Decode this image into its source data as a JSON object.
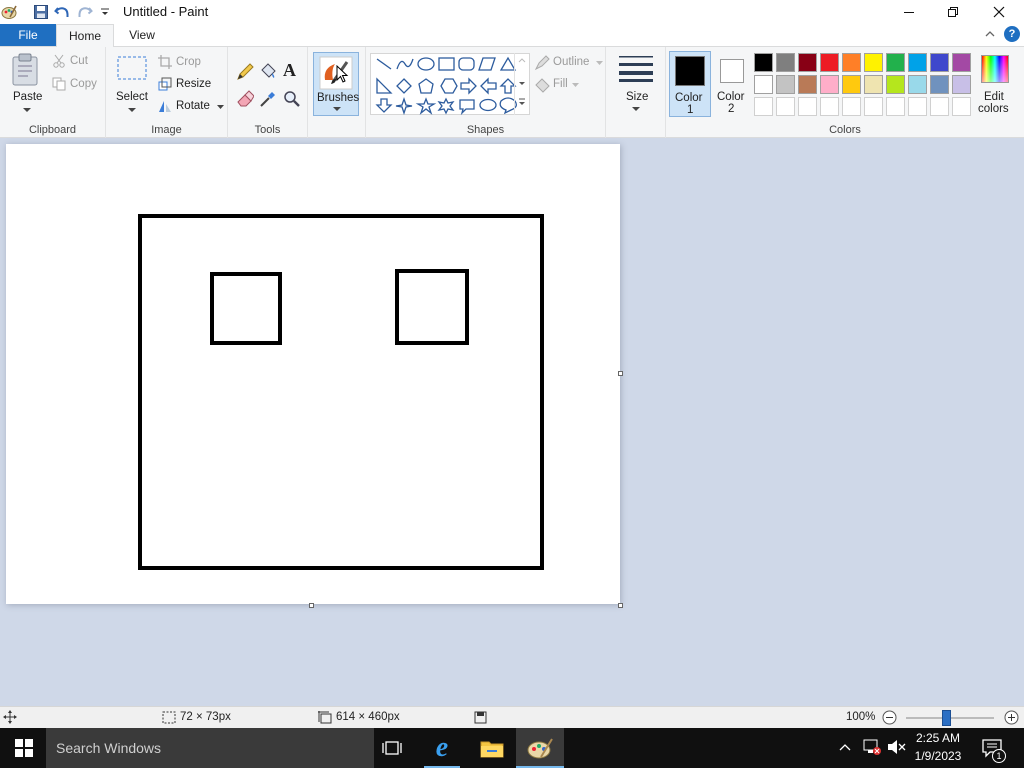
{
  "app": {
    "title": "Untitled - Paint"
  },
  "tabs": {
    "file": "File",
    "home": "Home",
    "view": "View"
  },
  "ribbon": {
    "clipboard": {
      "paste": "Paste",
      "cut": "Cut",
      "copy": "Copy",
      "group": "Clipboard"
    },
    "image": {
      "select": "Select",
      "crop": "Crop",
      "resize": "Resize",
      "rotate": "Rotate",
      "group": "Image"
    },
    "tools": {
      "group": "Tools"
    },
    "brushes": {
      "label": "Brushes"
    },
    "shapes": {
      "outline": "Outline",
      "fill": "Fill",
      "group": "Shapes"
    },
    "size": {
      "label": "Size"
    },
    "colors": {
      "color1": "Color 1",
      "color1_a": "Color",
      "color1_b": "1",
      "color2": "Color 2",
      "color2_a": "Color",
      "color2_b": "2",
      "edit": "Edit colors",
      "edit_a": "Edit",
      "edit_b": "colors",
      "group": "Colors",
      "color1_value": "#000000",
      "color2_value": "#ffffff",
      "palette_row1": [
        "#000000",
        "#7f7f7f",
        "#880015",
        "#ed1c24",
        "#ff7f27",
        "#fff200",
        "#22b14c",
        "#00a2e8",
        "#3f48cc",
        "#a349a4"
      ],
      "palette_row2": [
        "#ffffff",
        "#c3c3c3",
        "#b97a57",
        "#ffaec9",
        "#ffc90e",
        "#efe4b0",
        "#b5e61d",
        "#99d9ea",
        "#7092be",
        "#c8bfe7"
      ]
    }
  },
  "status": {
    "selection_size": "72 × 73px",
    "canvas_size": "614 × 460px",
    "zoom": "100%",
    "zoom_fraction": 0.41
  },
  "taskbar": {
    "search": "Search Windows",
    "time": "2:25 AM",
    "date": "1/9/2023",
    "notifications": "1"
  }
}
